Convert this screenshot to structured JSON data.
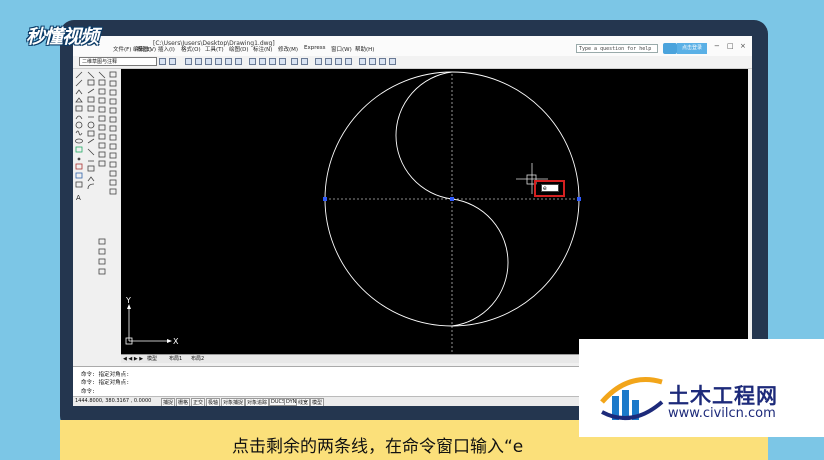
{
  "logo": {
    "text": "秒懂视频"
  },
  "window": {
    "title": "[C:\\Users\\Jusers\\Desktop\\Drawing1.dwg]",
    "help_placeholder": "Type a question for help",
    "login_label": "点击登录",
    "controls": [
      "−",
      "□",
      "×"
    ]
  },
  "menu": [
    {
      "label": "文件(F)"
    },
    {
      "label": "编辑(E)"
    },
    {
      "label": "视图(V)"
    },
    {
      "label": "插入(I)"
    },
    {
      "label": "格式(O)"
    },
    {
      "label": "工具(T)"
    },
    {
      "label": "绘图(D)"
    },
    {
      "label": "标注(N)"
    },
    {
      "label": "修改(M)"
    },
    {
      "label": "Express"
    },
    {
      "label": "窗口(W)"
    },
    {
      "label": "帮助(H)"
    }
  ],
  "workspace": {
    "selected": "二维草图与注释"
  },
  "canvas": {
    "ucs_x": "X",
    "ucs_y": "Y",
    "tooltip_value": "e",
    "colors": {
      "background": "#000000",
      "geometry": "#ffffff",
      "grip": "#2f5bff",
      "highlight": "#d42020"
    }
  },
  "tabs": {
    "nav": "◀ ◀ ▶ ▶",
    "model": "模型",
    "layout1": "布局1",
    "layout2": "布局2"
  },
  "command": {
    "lines": [
      "命令: 指定对角点:",
      "命令: 指定对角点:",
      "命令:"
    ]
  },
  "status": {
    "coords": "1444.8000, 380.3167 , 0.0000",
    "buttons": [
      "捕捉",
      "栅格",
      "正交",
      "极轴",
      "对象捕捉",
      "对象追踪",
      "DUCS",
      "DYN",
      "线宽",
      "模型"
    ]
  },
  "subtitle": {
    "text": "点击剩余的两条线，在命令窗口输入“e"
  },
  "watermark": {
    "title": "土木工程网",
    "url": "www.civilcn.com"
  }
}
